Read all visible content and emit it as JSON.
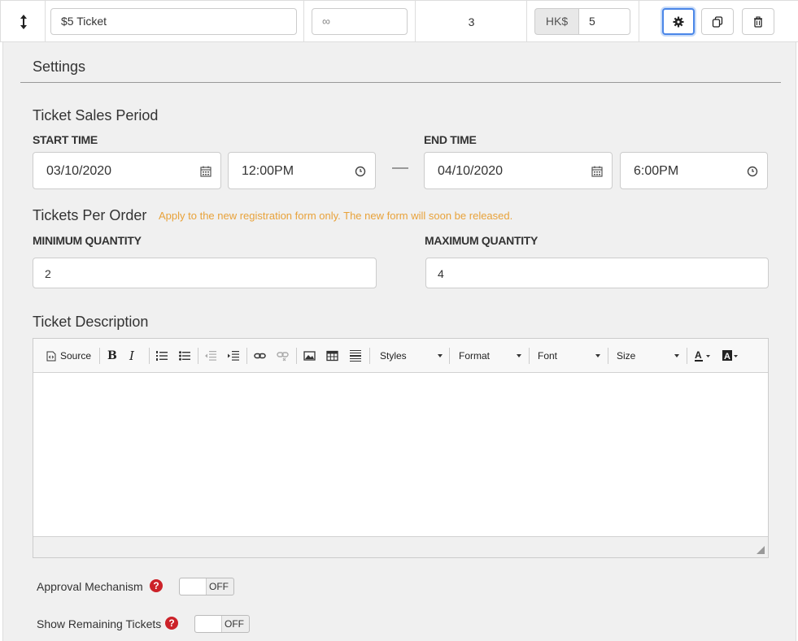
{
  "ticket_row": {
    "name": "$5 Ticket",
    "quantity_placeholder": "∞",
    "sold_count": "3",
    "currency": "HK$",
    "price": "5"
  },
  "settings": {
    "title": "Settings",
    "sales_period": {
      "heading": "Ticket Sales Period",
      "start_label": "START TIME",
      "start_date": "03/10/2020",
      "start_time": "12:00PM",
      "end_label": "END TIME",
      "end_date": "04/10/2020",
      "end_time": "6:00PM"
    },
    "per_order": {
      "heading": "Tickets Per Order",
      "note": "Apply to the new registration form only. The new form will soon be released.",
      "min_label": "MINIMUM QUANTITY",
      "min_value": "2",
      "max_label": "MAXIMUM QUANTITY",
      "max_value": "4"
    },
    "description": {
      "heading": "Ticket Description",
      "toolbar": {
        "source_label": "Source",
        "styles_label": "Styles",
        "format_label": "Format",
        "font_label": "Font",
        "size_label": "Size"
      }
    },
    "approval": {
      "label": "Approval Mechanism",
      "state": "OFF"
    },
    "remaining": {
      "label": "Show Remaining Tickets",
      "state": "OFF"
    }
  },
  "colors": {
    "accent": "#4a86e8",
    "note": "#e8a23a",
    "help": "#cc2229"
  }
}
